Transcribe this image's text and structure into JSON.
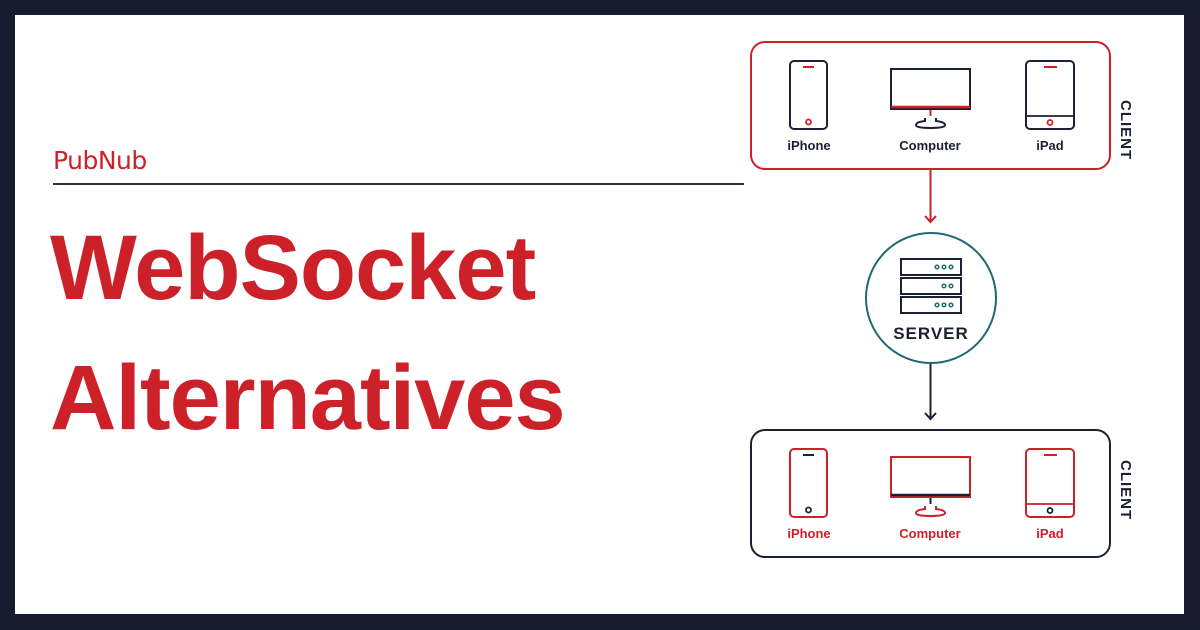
{
  "brand": {
    "name": "PubNub"
  },
  "title": {
    "line1": "WebSocket",
    "line2": "Alternatives"
  },
  "colors": {
    "brand_red": "#cc2129",
    "navy": "#161b2e",
    "teal": "#1e6a72",
    "text_dark": "#1b2033"
  },
  "diagram": {
    "top_client": {
      "label": "CLIENT",
      "devices": [
        {
          "icon": "phone-icon",
          "label": "iPhone"
        },
        {
          "icon": "monitor-icon",
          "label": "Computer"
        },
        {
          "icon": "tablet-icon",
          "label": "iPad"
        }
      ]
    },
    "server": {
      "label": "SERVER",
      "icon": "server-rack-icon"
    },
    "bottom_client": {
      "label": "CLIENT",
      "devices": [
        {
          "icon": "phone-icon",
          "label": "iPhone"
        },
        {
          "icon": "monitor-icon",
          "label": "Computer"
        },
        {
          "icon": "tablet-icon",
          "label": "iPad"
        }
      ]
    }
  }
}
